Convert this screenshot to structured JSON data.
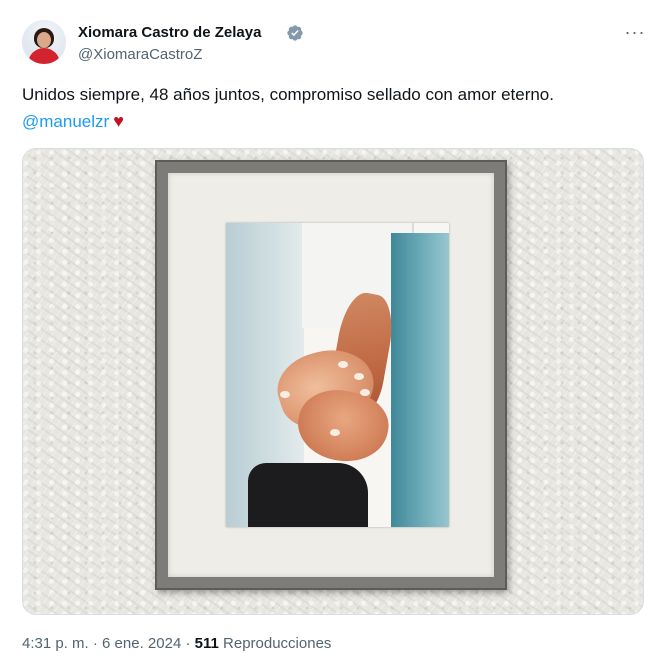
{
  "author": {
    "name": "Xiomara Castro de Zelaya",
    "handle": "@XiomaraCastroZ"
  },
  "tweet": {
    "text": "Unidos siempre, 48 años juntos, compromiso sellado con amor eterno.",
    "mention": "@manuelzr",
    "heart": "♥"
  },
  "menu": {
    "more_label": "···"
  },
  "meta": {
    "time": "4:31 p. m.",
    "sep1": "·",
    "date": "6 ene. 2024",
    "sep2": "·",
    "views_count": "511",
    "views_label": "Reproducciones"
  },
  "colors": {
    "accent": "#1d9bf0",
    "verified_badge": "#829aab",
    "heart": "#c1121f",
    "secondary_text": "#536471"
  }
}
